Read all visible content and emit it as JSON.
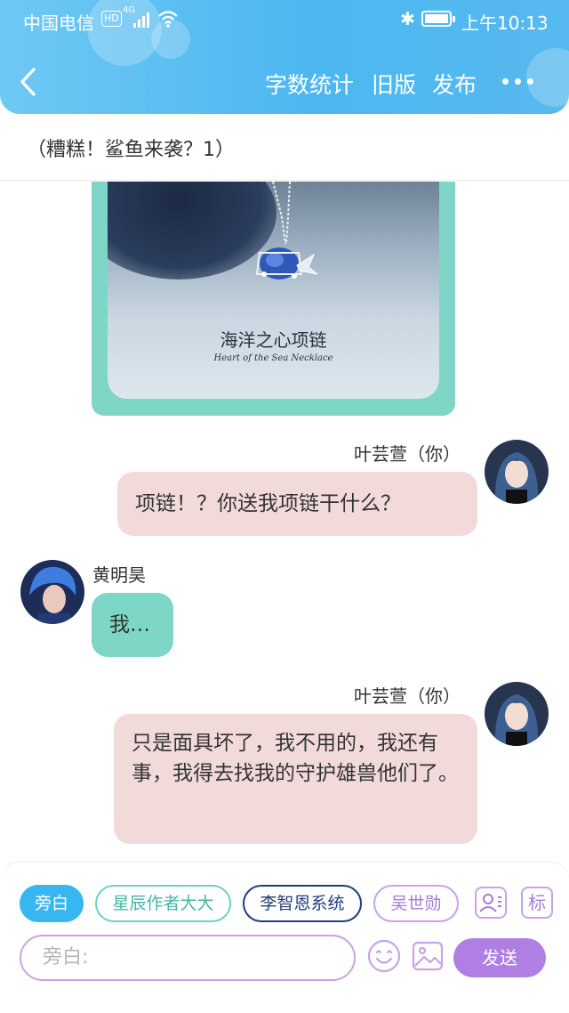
{
  "status_bar": {
    "carrier": "中国电信",
    "hd": "HD",
    "network": "4G",
    "time": "上午10:13"
  },
  "nav": {
    "word_count": "字数统计",
    "old_version": "旧版",
    "publish": "发布"
  },
  "chapter": {
    "title": "（糟糕！鲨鱼来袭？1）"
  },
  "image_card": {
    "caption_cn": "海洋之心项链",
    "caption_en": "Heart of the Sea Necklace"
  },
  "messages": [
    {
      "sender": "叶芸萱（你）",
      "text": "项链！？你送我项链干什么？"
    },
    {
      "sender": "黄明昊",
      "text": "我…"
    },
    {
      "sender": "叶芸萱（你）",
      "text": "只是面具坏了，我不用的，我还有事，我得去找我的守护雄兽他们了。"
    }
  ],
  "roles": {
    "narration": "旁白",
    "role1": "星辰作者大大",
    "role2": "李智恩系统",
    "role3": "吴世勋",
    "mark": "标"
  },
  "composer": {
    "placeholder": "旁白:",
    "send": "发送"
  },
  "colors": {
    "header": "#4cb7f0",
    "teal": "#7dd6c6",
    "pink": "#f2dadb",
    "purple": "#b07fe3",
    "navy": "#223f7a"
  }
}
